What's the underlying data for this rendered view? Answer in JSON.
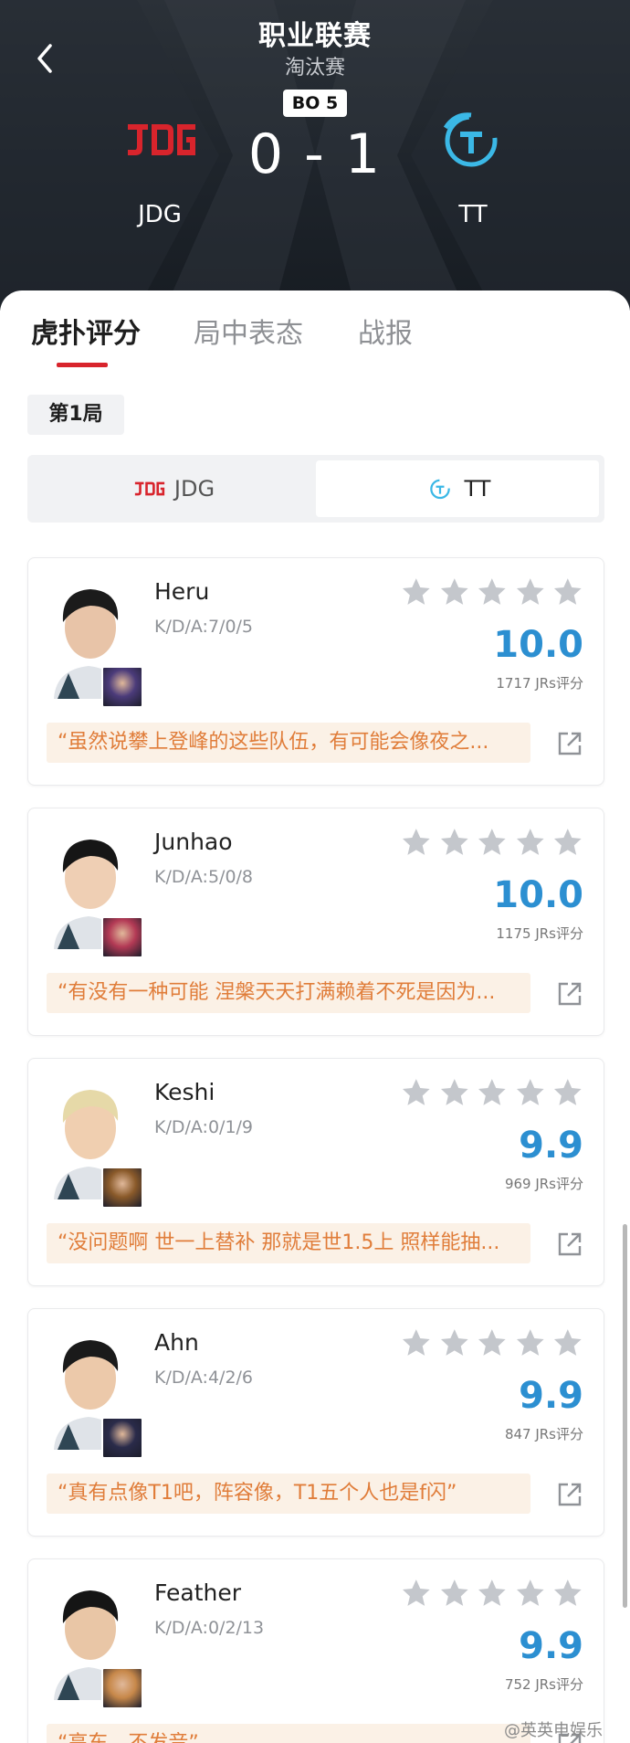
{
  "header": {
    "title": "职业联赛",
    "subtitle": "淘汰赛",
    "series_format": "BO 5",
    "score": "0 - 1",
    "team_left": {
      "name": "JDG",
      "logo": "jdg-logo",
      "color": "#d8242c"
    },
    "team_right": {
      "name": "TT",
      "logo": "tt-logo",
      "color": "#3bb8e6"
    }
  },
  "tabs": [
    {
      "label": "虎扑评分",
      "active": true
    },
    {
      "label": "局中表态",
      "active": false
    },
    {
      "label": "战报",
      "active": false
    }
  ],
  "round": {
    "label": "第1局"
  },
  "team_switch": {
    "left": {
      "label": "JDG",
      "selected": false
    },
    "right": {
      "label": "TT",
      "selected": true
    }
  },
  "players": [
    {
      "name": "Heru",
      "kda": "K/D/A:7/0/5",
      "rating": "10.0",
      "votes": "1717 JRs评分",
      "comment": "“虽然说攀上登峰的这些队伍，有可能会像夜之...",
      "stars": 5
    },
    {
      "name": "Junhao",
      "kda": "K/D/A:5/0/8",
      "rating": "10.0",
      "votes": "1175 JRs评分",
      "comment": "“有没有一种可能 涅槃天天打满赖着不死是因为...",
      "stars": 5
    },
    {
      "name": "Keshi",
      "kda": "K/D/A:0/1/9",
      "rating": "9.9",
      "votes": "969 JRs评分",
      "comment": "“没问题啊 世一上替补 那就是世1.5上 照样能抽...",
      "stars": 5
    },
    {
      "name": "Ahn",
      "kda": "K/D/A:4/2/6",
      "rating": "9.9",
      "votes": "847 JRs评分",
      "comment": "“真有点像T1吧，阵容像，T1五个人也是f闪”",
      "stars": 5
    },
    {
      "name": "Feather",
      "kda": "K/D/A:0/2/13",
      "rating": "9.9",
      "votes": "752 JRs评分",
      "comment": "“高东，不发音”",
      "stars": 5
    }
  ],
  "watermark": "@英英电娱乐",
  "colors": {
    "accent_red": "#d8242c",
    "rating_blue": "#2c8fd1",
    "comment_orange": "#e07d3a",
    "star_gray": "#c4c7cc"
  }
}
